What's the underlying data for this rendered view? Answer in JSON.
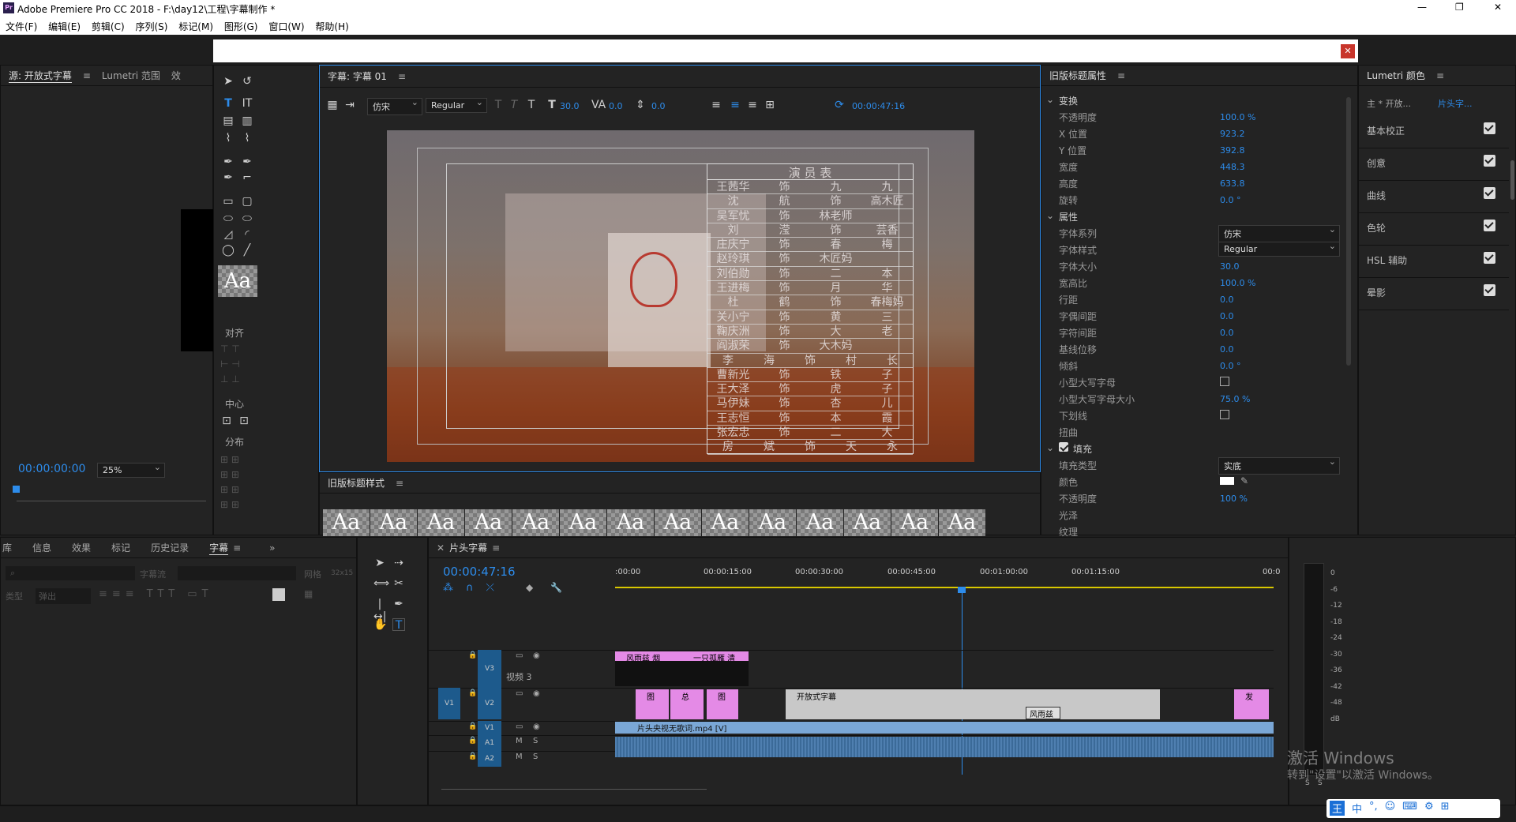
{
  "window": {
    "title": "Adobe Premiere Pro CC 2018 - F:\\day12\\工程\\字幕制作 *",
    "minimize": "—",
    "maximize": "❐",
    "close": "✕"
  },
  "menu": [
    "文件(F)",
    "编辑(E)",
    "剪辑(C)",
    "序列(S)",
    "标记(M)",
    "图形(G)",
    "窗口(W)",
    "帮助(H)"
  ],
  "source_panel": {
    "tabs": [
      "源: 开放式字幕",
      "Lumetri 范围",
      "效"
    ],
    "timecode": "00:00:00:00",
    "zoom": "25%"
  },
  "title_tools": {
    "align_label": "对齐",
    "center_label": "中心",
    "distribute_label": "分布",
    "style_sample": "Aa"
  },
  "title_panel": {
    "tab": "字幕: 字幕 01",
    "font": "仿宋",
    "style": "Regular",
    "size": "30.0",
    "kerning": "0.0",
    "leading": "0.0",
    "timecode": "00:00:47:16",
    "table_title": "演 员 表",
    "credits": [
      [
        "王茜华",
        "饰",
        "九",
        "九"
      ],
      [
        "沈",
        "航",
        "饰",
        "高木匠"
      ],
      [
        "吴军忧",
        "饰",
        "林老师",
        ""
      ],
      [
        "刘",
        "滢",
        "饰",
        "芸香"
      ],
      [
        "庄庆宁",
        "饰",
        "春",
        "梅"
      ],
      [
        "赵玲琪",
        "饰",
        "木匠妈",
        ""
      ],
      [
        "刘伯勋",
        "饰",
        "二",
        "本"
      ],
      [
        "王进梅",
        "饰",
        "月",
        "华"
      ],
      [
        "杜",
        "鹤",
        "饰",
        "春梅妈"
      ],
      [
        "关小宁",
        "饰",
        "黄",
        "三"
      ],
      [
        "鞠庆洲",
        "饰",
        "大",
        "老"
      ],
      [
        "阎淑荣",
        "饰",
        "大木妈",
        ""
      ],
      [
        "李",
        "海",
        "饰",
        "村",
        "长"
      ],
      [
        "曹新光",
        "饰",
        "铁",
        "子"
      ],
      [
        "王大泽",
        "饰",
        "虎",
        "子"
      ],
      [
        "马伊妹",
        "饰",
        "杏",
        "儿"
      ],
      [
        "王志恒",
        "饰",
        "本",
        "霞"
      ],
      [
        "张宏忠",
        "饰",
        "二",
        "大"
      ],
      [
        "房",
        "斌",
        "饰",
        "天",
        "永"
      ]
    ]
  },
  "styles_panel": {
    "title": "旧版标题样式",
    "samples": [
      "Aa",
      "Aa",
      "Aa",
      "Aa",
      "Aa",
      "Aa",
      "Aa",
      "Aa",
      "Aa",
      "Aa",
      "Aa",
      "Aa",
      "Aa",
      "Aa"
    ]
  },
  "properties": {
    "title": "旧版标题属性",
    "transform": {
      "label": "变换",
      "rows": [
        [
          "不透明度",
          "100.0 %"
        ],
        [
          "X 位置",
          "923.2"
        ],
        [
          "Y 位置",
          "392.8"
        ],
        [
          "宽度",
          "448.3"
        ],
        [
          "高度",
          "633.8"
        ],
        [
          "旋转",
          "0.0 °"
        ]
      ]
    },
    "attributes": {
      "label": "属性",
      "rows": [
        [
          "字体系列",
          "仿宋"
        ],
        [
          "字体样式",
          "Regular"
        ],
        [
          "字体大小",
          "30.0"
        ],
        [
          "宽高比",
          "100.0 %"
        ],
        [
          "行距",
          "0.0"
        ],
        [
          "字偶间距",
          "0.0"
        ],
        [
          "字符间距",
          "0.0"
        ],
        [
          "基线位移",
          "0.0"
        ],
        [
          "倾斜",
          "0.0 °"
        ],
        [
          "小型大写字母",
          ""
        ],
        [
          "小型大写字母大小",
          "75.0 %"
        ],
        [
          "下划线",
          ""
        ],
        [
          "扭曲",
          ""
        ]
      ]
    },
    "fill": {
      "label": "填充",
      "rows": [
        [
          "填充类型",
          "实底"
        ],
        [
          "颜色",
          ""
        ],
        [
          "不透明度",
          "100 %"
        ],
        [
          "光泽",
          ""
        ],
        [
          "纹理",
          ""
        ]
      ]
    }
  },
  "lumetri": {
    "title": "Lumetri 颜色",
    "master": "主 * 开放...",
    "clip": "片头字...",
    "sections": [
      "基本校正",
      "创意",
      "曲线",
      "色轮",
      "HSL 辅助",
      "晕影"
    ]
  },
  "bottom_left": {
    "tabs": [
      "库",
      "信息",
      "效果",
      "标记",
      "历史记录",
      "字幕"
    ],
    "search_placeholder": "字幕流",
    "grid_label": "网格",
    "grid_value": "32x15",
    "type_label": "类型",
    "type_value": "弹出"
  },
  "timeline": {
    "tab": "片头字幕",
    "timecode": "00:00:47:16",
    "ruler": [
      ":00:00",
      "00:00:15:00",
      "00:00:30:00",
      "00:00:45:00",
      "00:01:00:00",
      "00:01:15:00",
      "00:0"
    ],
    "tracks": [
      {
        "id": "V3",
        "name": "视频 3"
      },
      {
        "id": "V2",
        "name": ""
      },
      {
        "id": "V1",
        "name": ""
      },
      {
        "id": "A1",
        "name": ""
      },
      {
        "id": "A2",
        "name": ""
      }
    ],
    "clips": {
      "v3": [
        "风雨兹 烟",
        "一只孤雁 清"
      ],
      "v2": [
        "图",
        "总",
        "图",
        "开放式字幕",
        "风雨兹",
        "发"
      ],
      "v1": "片头央视无歌词.mp4 [V]"
    }
  },
  "meter": {
    "labels": [
      "0",
      "-6",
      "-12",
      "-18",
      "-24",
      "-30",
      "-36",
      "-42",
      "-48",
      "dB"
    ],
    "solo": [
      "S",
      "S"
    ]
  },
  "watermark": {
    "line1": "激活 Windows",
    "line2": "转到\"设置\"以激活 Windows。"
  },
  "ime": [
    "王",
    "中",
    "°,",
    "☺",
    "⌨",
    "⚙",
    "⊞"
  ]
}
